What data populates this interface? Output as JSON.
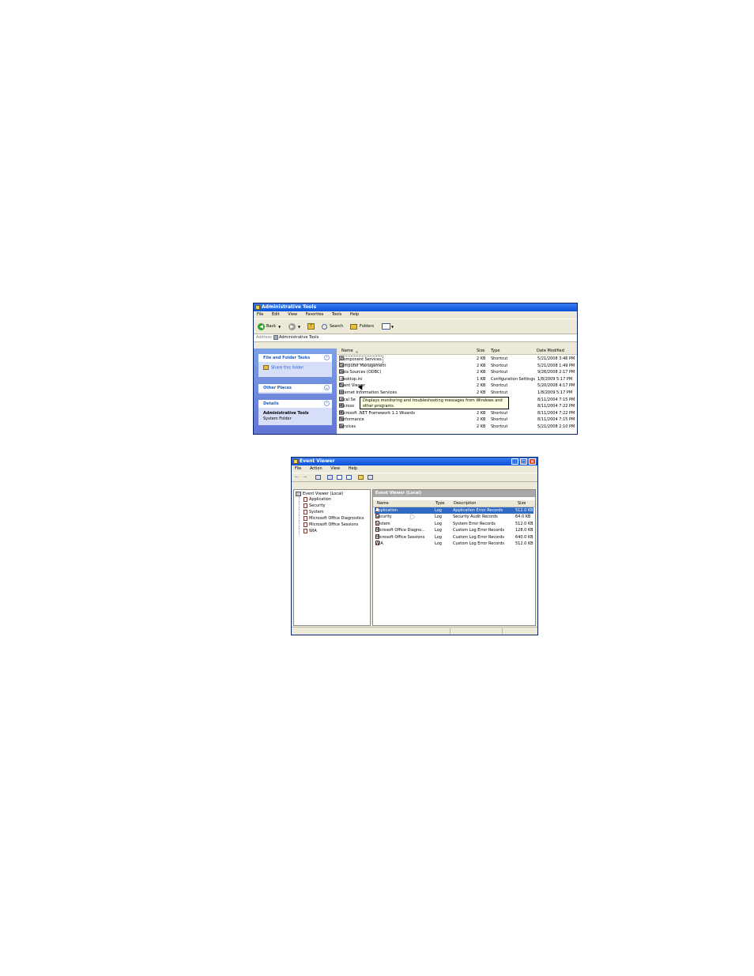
{
  "admin_window": {
    "title": "Administrative Tools",
    "menu": [
      "File",
      "Edit",
      "View",
      "Favorites",
      "Tools",
      "Help"
    ],
    "toolbar": {
      "back_label": "Back",
      "search_label": "Search",
      "folders_label": "Folders"
    },
    "address": {
      "label": "Address",
      "value": "Administrative Tools"
    },
    "tasks": {
      "file_folder_title": "File and Folder Tasks",
      "share_label": "Share this folder",
      "other_places_title": "Other Places",
      "details_title": "Details",
      "details_name": "Administrative Tools",
      "details_type": "System Folder"
    },
    "columns": {
      "name": "Name",
      "size": "Size",
      "type": "Type",
      "date": "Date Modified"
    },
    "rows": [
      {
        "name": "Component Services",
        "size": "2 KB",
        "type": "Shortcut",
        "date": "5/21/2008 3:46 PM"
      },
      {
        "name": "Computer Management",
        "size": "2 KB",
        "type": "Shortcut",
        "date": "5/21/2008 1:49 PM"
      },
      {
        "name": "Data Sources (ODBC)",
        "size": "2 KB",
        "type": "Shortcut",
        "date": "9/26/2008 2:17 PM"
      },
      {
        "name": "desktop.ini",
        "size": "1 KB",
        "type": "Configuration Settings",
        "date": "1/8/2009 5:17 PM"
      },
      {
        "name": "Event Viewer",
        "size": "2 KB",
        "type": "Shortcut",
        "date": "5/20/2008 4:17 PM"
      },
      {
        "name": "Internet Information Services",
        "size": "2 KB",
        "type": "Shortcut",
        "date": "1/8/2009 5:17 PM"
      },
      {
        "name": "Local Se",
        "size": "",
        "type": "",
        "date": "8/11/2004 7:15 PM"
      },
      {
        "name": "Microso",
        "size": "",
        "type": "",
        "date": "8/11/2004 7:22 PM"
      },
      {
        "name": "Microsoft .NET Framework 1.1 Wizards",
        "size": "2 KB",
        "type": "Shortcut",
        "date": "8/11/2004 7:22 PM"
      },
      {
        "name": "Performance",
        "size": "2 KB",
        "type": "Shortcut",
        "date": "8/11/2004 7:15 PM"
      },
      {
        "name": "Services",
        "size": "2 KB",
        "type": "Shortcut",
        "date": "5/21/2008 2:10 PM"
      }
    ],
    "tooltip": "Displays monitoring and troubleshooting messages from Windows and other programs."
  },
  "event_window": {
    "title": "Event Viewer",
    "menu": [
      "File",
      "Action",
      "View",
      "Help"
    ],
    "tree_root": "Event Viewer (Local)",
    "tree_items": [
      "Application",
      "Security",
      "System",
      "Microsoft Office Diagnostics",
      "Microsoft Office Sessions",
      "WIA"
    ],
    "pane_title": "Event Viewer (Local)",
    "columns": {
      "name": "Name",
      "type": "Type",
      "description": "Description",
      "size": "Size"
    },
    "rows": [
      {
        "name": "Application",
        "type": "Log",
        "description": "Application Error Records",
        "size": "512.0 KB"
      },
      {
        "name": "Security",
        "type": "Log",
        "description": "Security Audit Records",
        "size": "64.0 KB"
      },
      {
        "name": "System",
        "type": "Log",
        "description": "System Error Records",
        "size": "512.0 KB"
      },
      {
        "name": "Microsoft Office Diagno...",
        "type": "Log",
        "description": "Custom Log Error Records",
        "size": "128.0 KB"
      },
      {
        "name": "Microsoft Office Sessions",
        "type": "Log",
        "description": "Custom Log Error Records",
        "size": "640.0 KB"
      },
      {
        "name": "WIA",
        "type": "Log",
        "description": "Custom Log Error Records",
        "size": "512.0 KB"
      }
    ],
    "colors": {
      "selected_row": "#316ac5"
    }
  }
}
